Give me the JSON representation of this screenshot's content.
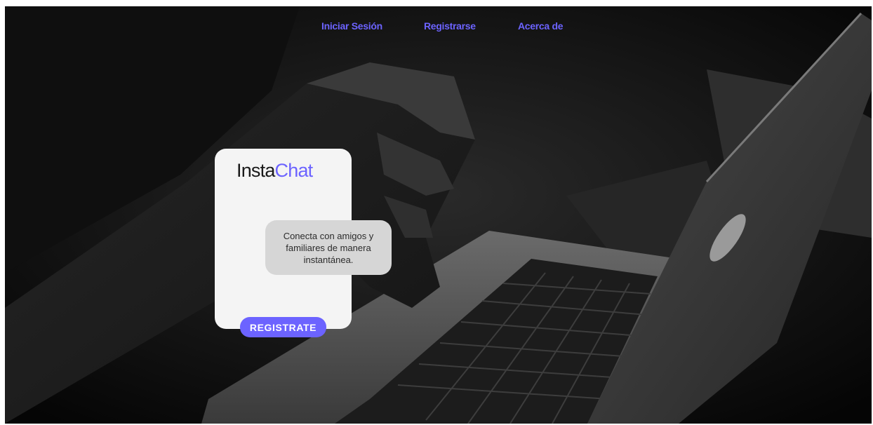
{
  "nav": {
    "login": "Iniciar Sesión",
    "register": "Registrarse",
    "about": "Acerca de"
  },
  "brand": {
    "part1": "Insta",
    "part2": "Chat"
  },
  "hero": {
    "tagline": "Conecta con amigos y familiares de manera instantánea.",
    "cta_label": "REGISTRATE"
  },
  "background": {
    "icon": "laptop-typing-photo-icon",
    "description_free": true
  },
  "colors": {
    "accent": "#6c63ff",
    "card": "#f4f4f4",
    "bubble": "#d6d6d6",
    "background": "#0a0a0a"
  }
}
